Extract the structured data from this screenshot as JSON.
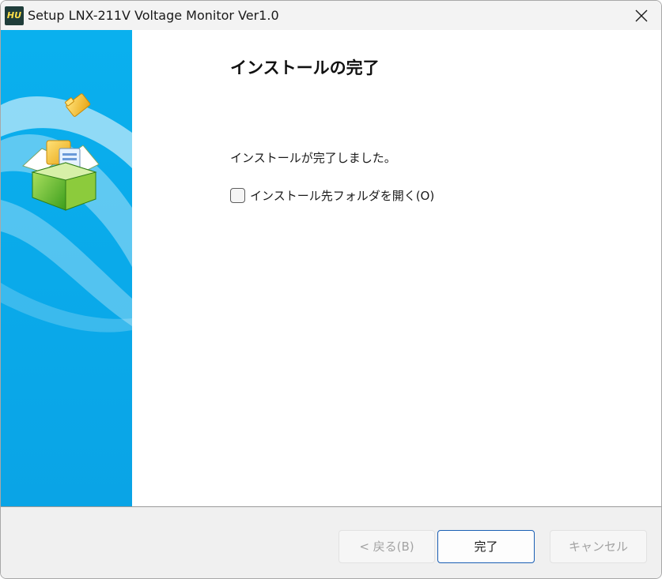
{
  "window": {
    "title": "Setup LNX-211V Voltage Monitor Ver1.0",
    "app_icon_text": "HU"
  },
  "main": {
    "heading": "インストールの完了",
    "message": "インストールが完了しました。",
    "open_folder_checkbox": {
      "label": "インストール先フォルダを開く(O)",
      "checked": false
    }
  },
  "footer": {
    "back_label": "< 戻る(B)",
    "finish_label": "完了",
    "cancel_label": "キャンセル"
  },
  "colors": {
    "banner_blue": "#0aa8ea",
    "accent_border": "#1a5fb4",
    "footer_bg": "#f0f0f0"
  },
  "icons": [
    "app-icon",
    "close-icon",
    "install-box-icon"
  ]
}
